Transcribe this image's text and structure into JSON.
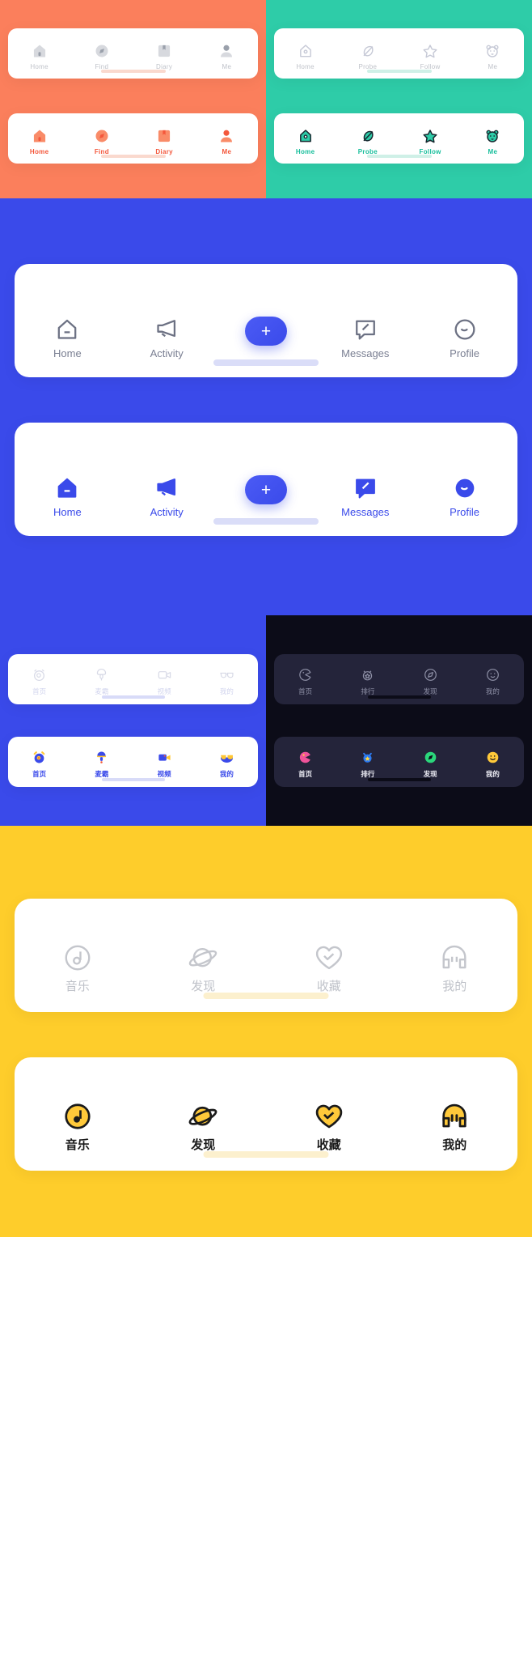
{
  "sections": [
    {
      "id": "orange",
      "name": "orange-tabbar-set",
      "background": "#FB7F5C",
      "accent": "#F4573B",
      "bars": [
        {
          "state": "inactive",
          "items": [
            {
              "icon": "home-icon",
              "label": "Home"
            },
            {
              "icon": "compass-icon",
              "label": "Find"
            },
            {
              "icon": "book-icon",
              "label": "Diary"
            },
            {
              "icon": "person-icon",
              "label": "Me"
            }
          ]
        },
        {
          "state": "active",
          "items": [
            {
              "icon": "home-icon",
              "label": "Home"
            },
            {
              "icon": "compass-icon",
              "label": "Find"
            },
            {
              "icon": "book-icon",
              "label": "Diary"
            },
            {
              "icon": "person-icon",
              "label": "Me"
            }
          ]
        }
      ]
    },
    {
      "id": "green",
      "name": "green-tabbar-set",
      "background": "#2ECCA8",
      "accent": "#16BE9B",
      "bars": [
        {
          "state": "inactive",
          "items": [
            {
              "icon": "home-outline-icon",
              "label": "Home"
            },
            {
              "icon": "leaf-icon",
              "label": "Probe"
            },
            {
              "icon": "star-icon",
              "label": "Follow"
            },
            {
              "icon": "bear-icon",
              "label": "Me"
            }
          ]
        },
        {
          "state": "active",
          "items": [
            {
              "icon": "home-outline-icon",
              "label": "Home"
            },
            {
              "icon": "leaf-icon",
              "label": "Probe"
            },
            {
              "icon": "star-icon",
              "label": "Follow"
            },
            {
              "icon": "bear-icon",
              "label": "Me"
            }
          ]
        }
      ]
    },
    {
      "id": "blue",
      "name": "blue-tabbar-set",
      "background": "#3A4AEA",
      "accent": "#3A4AEA",
      "fab": {
        "icon": "plus-icon",
        "label": "+"
      },
      "bars": [
        {
          "state": "inactive",
          "items": [
            {
              "icon": "home-icon",
              "label": "Home"
            },
            {
              "icon": "megaphone-icon",
              "label": "Activity"
            },
            {
              "icon": "plus-icon",
              "label": ""
            },
            {
              "icon": "message-icon",
              "label": "Messages"
            },
            {
              "icon": "profile-icon",
              "label": "Profile"
            }
          ]
        },
        {
          "state": "active",
          "items": [
            {
              "icon": "home-icon",
              "label": "Home"
            },
            {
              "icon": "megaphone-icon",
              "label": "Activity"
            },
            {
              "icon": "plus-icon",
              "label": ""
            },
            {
              "icon": "message-icon",
              "label": "Messages"
            },
            {
              "icon": "profile-icon",
              "label": "Profile"
            }
          ]
        }
      ]
    },
    {
      "id": "blue-small",
      "name": "blue-cn-tabbar-set",
      "background": "#3A4AEA",
      "accent": "#3A4AEA",
      "bars": [
        {
          "state": "inactive",
          "items": [
            {
              "icon": "alarm-clock-icon",
              "label": "首页"
            },
            {
              "icon": "microphone-icon",
              "label": "麦霸"
            },
            {
              "icon": "video-camera-icon",
              "label": "视频"
            },
            {
              "icon": "sunglasses-icon",
              "label": "我的"
            }
          ]
        },
        {
          "state": "active",
          "items": [
            {
              "icon": "alarm-clock-icon",
              "label": "首页"
            },
            {
              "icon": "microphone-icon",
              "label": "麦霸"
            },
            {
              "icon": "video-camera-icon",
              "label": "视频"
            },
            {
              "icon": "sunglasses-icon",
              "label": "我的"
            }
          ]
        }
      ]
    },
    {
      "id": "dark",
      "name": "dark-cn-tabbar-set",
      "background": "#0C0C18",
      "accent": "#EDEDF5",
      "bars": [
        {
          "state": "inactive",
          "items": [
            {
              "icon": "pacman-icon",
              "label": "首页"
            },
            {
              "icon": "medal-icon",
              "label": "排行"
            },
            {
              "icon": "compass-icon",
              "label": "发现"
            },
            {
              "icon": "smiley-icon",
              "label": "我的"
            }
          ]
        },
        {
          "state": "active",
          "items": [
            {
              "icon": "pacman-icon",
              "label": "首页"
            },
            {
              "icon": "medal-icon",
              "label": "排行"
            },
            {
              "icon": "compass-icon",
              "label": "发现"
            },
            {
              "icon": "smiley-icon",
              "label": "我的"
            }
          ]
        }
      ]
    },
    {
      "id": "yellow",
      "name": "yellow-cn-tabbar-set",
      "background": "#FECD2B",
      "accent": "#1A1A1A",
      "bars": [
        {
          "state": "inactive",
          "items": [
            {
              "icon": "music-note-icon",
              "label": "音乐"
            },
            {
              "icon": "planet-icon",
              "label": "发现"
            },
            {
              "icon": "heart-icon",
              "label": "收藏"
            },
            {
              "icon": "headphone-face-icon",
              "label": "我的"
            }
          ]
        },
        {
          "state": "active",
          "items": [
            {
              "icon": "music-note-icon",
              "label": "音乐"
            },
            {
              "icon": "planet-icon",
              "label": "发现"
            },
            {
              "icon": "heart-icon",
              "label": "收藏"
            },
            {
              "icon": "headphone-face-icon",
              "label": "我的"
            }
          ]
        }
      ]
    }
  ]
}
